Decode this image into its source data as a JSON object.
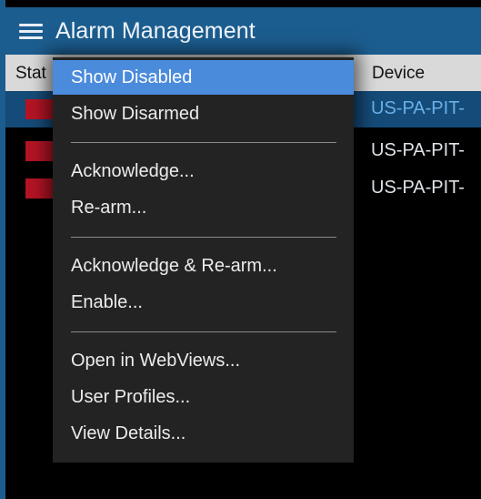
{
  "app": {
    "title": "Alarm Management"
  },
  "columns": {
    "status": "Stat",
    "device": "Device"
  },
  "rows": [
    {
      "device": "US-PA-PIT-",
      "status_color": "#b41424",
      "selected": true
    },
    {
      "device": "US-PA-PIT-",
      "status_color": "#b41424",
      "selected": false
    },
    {
      "device": "US-PA-PIT-",
      "status_color": "#b41424",
      "selected": false
    }
  ],
  "context_menu": {
    "items": [
      {
        "label": "Show Disabled",
        "active": true
      },
      {
        "label": "Show Disarmed"
      },
      {
        "label": "Acknowledge..."
      },
      {
        "label": "Re-arm..."
      },
      {
        "label": "Acknowledge & Re-arm..."
      },
      {
        "label": "Enable..."
      },
      {
        "label": "Open in WebViews..."
      },
      {
        "label": "User Profiles..."
      },
      {
        "label": "View Details..."
      }
    ]
  },
  "colors": {
    "header": "#1c5d8f",
    "menu_bg": "#232323",
    "menu_active": "#4b8bdc",
    "status_alarm": "#b41424",
    "selected_row": "#154b78"
  }
}
